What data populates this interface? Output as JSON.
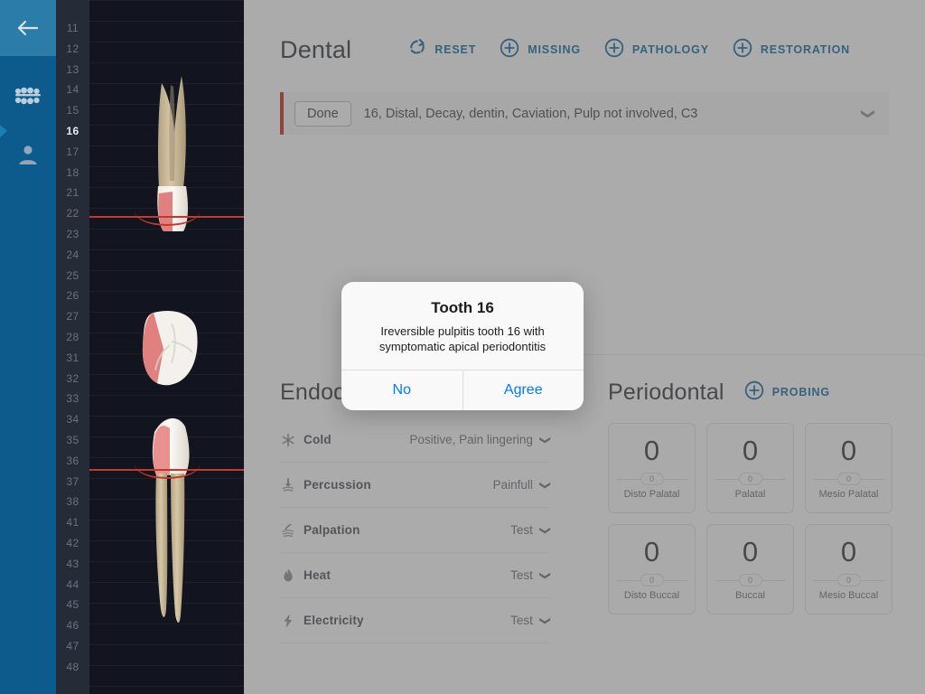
{
  "nav": {
    "back_icon": "arrow-left-icon",
    "items": [
      {
        "icon": "teeth-chart-icon",
        "name": "dental-chart"
      },
      {
        "icon": "person-icon",
        "name": "patient"
      }
    ]
  },
  "tooth_rail": {
    "active": "16",
    "numbers": [
      "11",
      "12",
      "13",
      "14",
      "15",
      "16",
      "17",
      "18",
      "21",
      "22",
      "23",
      "24",
      "25",
      "26",
      "27",
      "28",
      "31",
      "32",
      "33",
      "34",
      "35",
      "36",
      "37",
      "38",
      "41",
      "42",
      "43",
      "44",
      "45",
      "46",
      "47",
      "48"
    ]
  },
  "viewport": {
    "name": "tooth-3d-viewport",
    "views": [
      "buccal-upper",
      "occlusal",
      "buccal-lower"
    ]
  },
  "header": {
    "title": "Dental",
    "buttons": [
      {
        "label": "RESET",
        "icon": "reset-icon"
      },
      {
        "label": "MISSING",
        "icon": "plus-circle-icon"
      },
      {
        "label": "PATHOLOGY",
        "icon": "plus-circle-icon"
      },
      {
        "label": "RESTORATION",
        "icon": "plus-circle-icon"
      }
    ]
  },
  "diagnosis": {
    "status": "Done",
    "text": "16, Distal, Decay, dentin, Caviation, Pulp not involved, C3",
    "chevron": "chevron-down-icon"
  },
  "endodontic": {
    "title": "Endodontic",
    "rows": [
      {
        "icon": "snowflake-icon",
        "name": "Cold",
        "value": "Positive, Pain lingering"
      },
      {
        "icon": "percussion-icon",
        "name": "Percussion",
        "value": "Painfull"
      },
      {
        "icon": "palpation-icon",
        "name": "Palpation",
        "value": "Test"
      },
      {
        "icon": "flame-icon",
        "name": "Heat",
        "value": "Test"
      },
      {
        "icon": "bolt-icon",
        "name": "Electricity",
        "value": "Test"
      }
    ]
  },
  "periodontal": {
    "title": "Periodontal",
    "action": {
      "label": "PROBING",
      "icon": "plus-circle-icon"
    },
    "cards": [
      {
        "value": "0",
        "pill": "0",
        "label": "Disto Palatal"
      },
      {
        "value": "0",
        "pill": "0",
        "label": "Palatal"
      },
      {
        "value": "0",
        "pill": "0",
        "label": "Mesio Palatal"
      },
      {
        "value": "0",
        "pill": "0",
        "label": "Disto Buccal"
      },
      {
        "value": "0",
        "pill": "0",
        "label": "Buccal"
      },
      {
        "value": "0",
        "pill": "0",
        "label": "Mesio Buccal"
      }
    ]
  },
  "modal": {
    "title": "Tooth 16",
    "message": "Ireversible pulpitis tooth 16 with symptomatic apical periodontitis",
    "no_label": "No",
    "agree_label": "Agree"
  },
  "colors": {
    "nav_bg": "#0d5a8c",
    "nav_back_bg": "#2b7ca8",
    "accent": "#1a6e9e",
    "modal_action": "#007aff",
    "alert_red": "#c0392b",
    "viewport_bg": "#12151f"
  }
}
